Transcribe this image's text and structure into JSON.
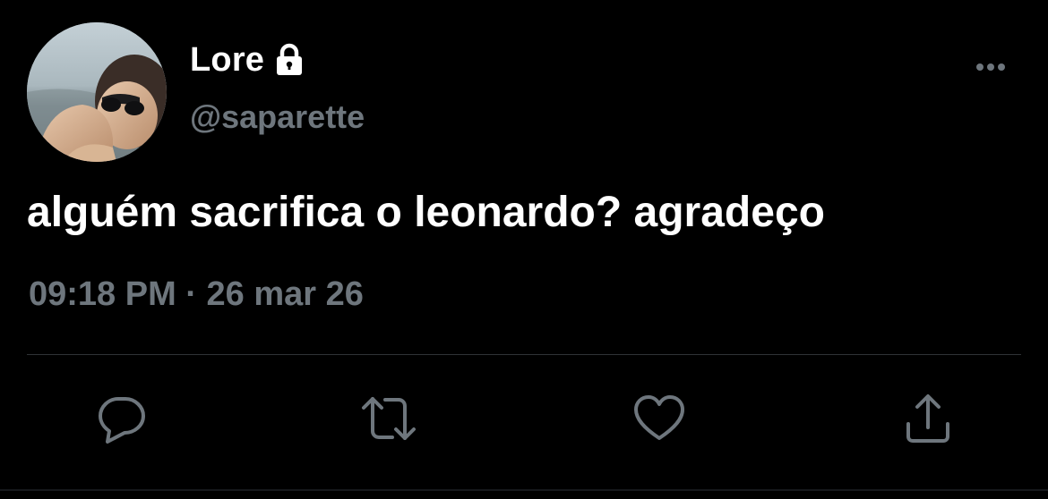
{
  "user": {
    "display_name": "Lore",
    "handle": "@saparette",
    "protected_icon": "lock-icon",
    "avatar_icon": "avatar-photo"
  },
  "tweet": {
    "text": "alguém sacrifica o leonardo? agradeço",
    "timestamp": "09:18 PM · 26 mar 26"
  },
  "actions": {
    "more": "more-options-icon",
    "reply": "reply-icon",
    "retweet": "retweet-icon",
    "like": "like-icon",
    "share": "share-icon"
  },
  "colors": {
    "background": "#000000",
    "primary_text": "#ffffff",
    "secondary_text": "#6e767d",
    "divider": "#2f3336"
  }
}
